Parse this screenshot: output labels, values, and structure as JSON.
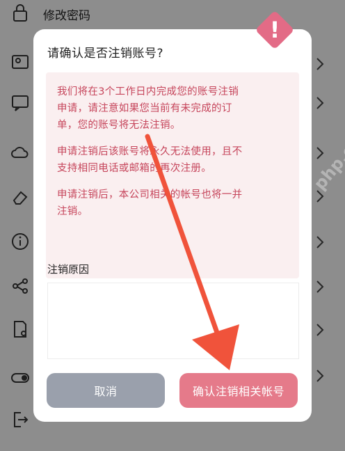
{
  "background": {
    "top_item_label": "修改密码",
    "rows": [
      {
        "icon": "lock-icon"
      },
      {
        "icon": "person-card-icon"
      },
      {
        "icon": "message-icon"
      },
      {
        "icon": "cloud-icon"
      },
      {
        "icon": "eraser-icon"
      },
      {
        "icon": "info-icon"
      },
      {
        "icon": "share-icon"
      },
      {
        "icon": "document-person-icon"
      },
      {
        "icon": "toggle-icon"
      },
      {
        "icon": "exit-icon"
      }
    ]
  },
  "dialog": {
    "title": "请确认是否注销账号?",
    "warning_badge_glyph": "!",
    "notice": {
      "line1a": "我们将在3个工作日内完成您的账号注销",
      "line1b": "申请，请注意如果您当前有未完成的订",
      "line1c": "单，您的账号将无法注销。",
      "line2a": "申请注销后该账号将永久无法使用，且不",
      "line2b": "支持相同电话或邮箱的再次注册。",
      "line3a": "申请注销后，本公司相关的帐号也将一并",
      "line3b": "注销。"
    },
    "reason_label": "注销原因",
    "reason_value": "",
    "cancel_label": "取消",
    "confirm_label": "确认注销相关帐号"
  },
  "watermark": "php.cn",
  "colors": {
    "notice_text": "#c6455b",
    "notice_bg": "#faeff0",
    "confirm_button": "#e57a8a",
    "cancel_button": "#9aa0ac",
    "warning_badge": "#e36b86",
    "arrow": "#f0533b"
  }
}
